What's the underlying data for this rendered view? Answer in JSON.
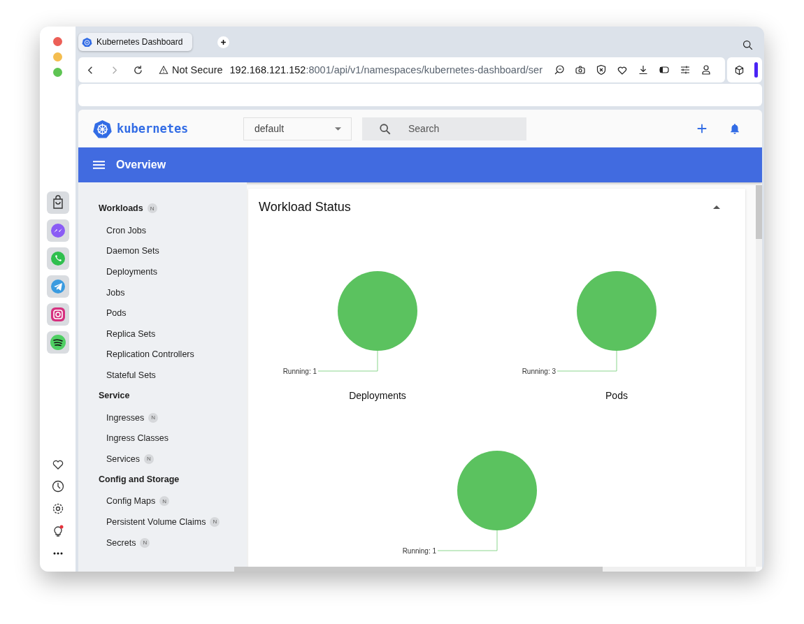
{
  "browser": {
    "tab": {
      "title": "Kubernetes Dashboard",
      "selected": true
    },
    "security": "Not Secure",
    "url": {
      "host": "192.168.121.152",
      "path": ":8001/api/v1/namespaces/kubernetes-dashboard/ser"
    }
  },
  "header": {
    "logo": "kubernetes",
    "namespace": {
      "value": "default"
    },
    "search": {
      "placeholder": "Search"
    }
  },
  "toolbar": {
    "title": "Overview"
  },
  "sidebar": {
    "sections": [
      {
        "title": "Workloads",
        "badge": "N",
        "items": [
          {
            "label": "Cron Jobs"
          },
          {
            "label": "Daemon Sets"
          },
          {
            "label": "Deployments"
          },
          {
            "label": "Jobs"
          },
          {
            "label": "Pods"
          },
          {
            "label": "Replica Sets"
          },
          {
            "label": "Replication Controllers"
          },
          {
            "label": "Stateful Sets"
          }
        ]
      },
      {
        "title": "Service",
        "items": [
          {
            "label": "Ingresses",
            "badge": "N"
          },
          {
            "label": "Ingress Classes"
          },
          {
            "label": "Services",
            "badge": "N"
          }
        ]
      },
      {
        "title": "Config and Storage",
        "items": [
          {
            "label": "Config Maps",
            "badge": "N"
          },
          {
            "label": "Persistent Volume Claims",
            "badge": "N"
          },
          {
            "label": "Secrets",
            "badge": "N"
          }
        ]
      }
    ]
  },
  "card": {
    "title": "Workload Status",
    "expanded": true,
    "charts": [
      {
        "title": "Deployments",
        "label": "Running: 1"
      },
      {
        "title": "Pods",
        "label": "Running: 3"
      },
      {
        "label": "Running: 1"
      }
    ]
  }
}
